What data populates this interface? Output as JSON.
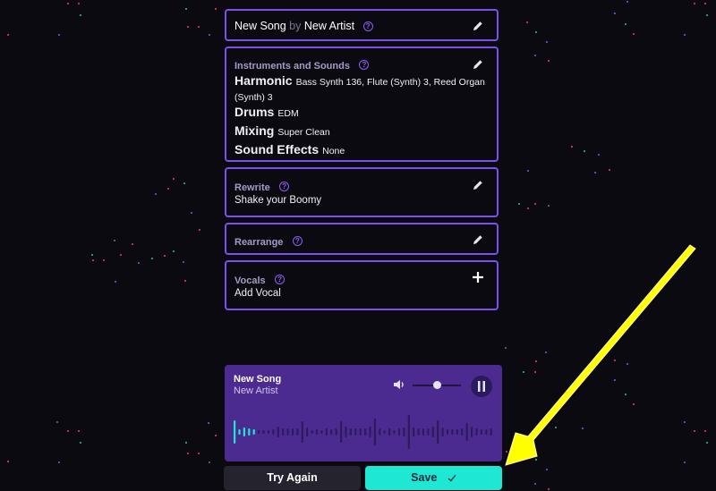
{
  "colors": {
    "background": "#0b0a10",
    "card_border": "#7c4ff0",
    "player_bg": "#4c2b91",
    "accent_teal": "#1ee8d3",
    "secondary_button": "#25232e",
    "arrow": "#ffff00"
  },
  "song_header": {
    "title": "New Song",
    "by": "by",
    "artist": "New Artist",
    "help_icon": "question-circle-icon",
    "edit_icon": "pencil-icon"
  },
  "instruments": {
    "title": "Instruments and Sounds",
    "rows": [
      {
        "label": "Harmonic",
        "value": "Bass Synth 136, Flute (Synth) 3, Reed Organ"
      },
      {
        "label": "",
        "value": "(Synth) 3"
      },
      {
        "label": "Drums",
        "value": "EDM"
      },
      {
        "label": "Mixing",
        "value": "Super Clean"
      },
      {
        "label": "Sound Effects",
        "value": "None"
      }
    ]
  },
  "rewrite": {
    "title": "Rewrite",
    "value": "Shake your Boomy"
  },
  "rearrange": {
    "title": "Rearrange"
  },
  "vocals": {
    "title": "Vocals",
    "value": "Add Vocal",
    "add_icon": "plus-icon"
  },
  "player": {
    "title": "New Song",
    "artist": "New Artist",
    "volume_icon": "speaker-icon",
    "volume_level": 0.5,
    "pause_icon": "pause-icon",
    "progress": 0.03
  },
  "buttons": {
    "try_again": "Try Again",
    "save": "Save",
    "save_icon": "checkmark-icon"
  },
  "annotation": {
    "arrow": "yellow-arrow-pointing-to-save"
  }
}
